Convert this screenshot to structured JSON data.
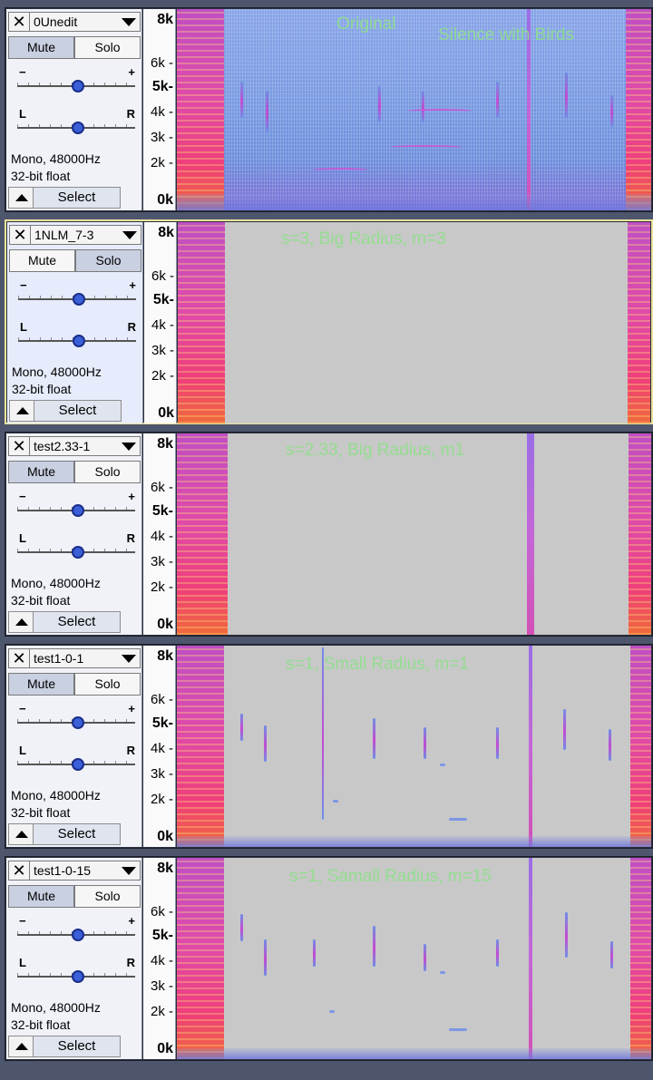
{
  "tracks": [
    {
      "name": "0Unedit",
      "mute_label": "Mute",
      "solo_label": "Solo",
      "gain_minus": "−",
      "gain_plus": "+",
      "pan_left": "L",
      "pan_right": "R",
      "info_line1": "Mono, 48000Hz",
      "info_line2": "32-bit float",
      "select_label": "Select",
      "annotations": [
        "Original",
        "Silence with Birds"
      ],
      "ticks": [
        "8k",
        "6k -",
        "5k-",
        "4k -",
        "3k -",
        "2k -",
        "0k"
      ]
    },
    {
      "name": "1NLM_7-3",
      "mute_label": "Mute",
      "solo_label": "Solo",
      "gain_minus": "−",
      "gain_plus": "+",
      "pan_left": "L",
      "pan_right": "R",
      "info_line1": "Mono, 48000Hz",
      "info_line2": "32-bit float",
      "select_label": "Select",
      "annotations": [
        "s=3, Big Radius, m=3"
      ],
      "ticks": [
        "8k",
        "6k -",
        "5k-",
        "4k -",
        "3k -",
        "2k -",
        "0k"
      ]
    },
    {
      "name": "test2.33-1",
      "mute_label": "Mute",
      "solo_label": "Solo",
      "gain_minus": "−",
      "gain_plus": "+",
      "pan_left": "L",
      "pan_right": "R",
      "info_line1": "Mono, 48000Hz",
      "info_line2": "32-bit float",
      "select_label": "Select",
      "annotations": [
        "s=2.33, Big Radius, m1"
      ],
      "ticks": [
        "8k",
        "6k -",
        "5k-",
        "4k -",
        "3k -",
        "2k -",
        "0k"
      ]
    },
    {
      "name": "test1-0-1",
      "mute_label": "Mute",
      "solo_label": "Solo",
      "gain_minus": "−",
      "gain_plus": "+",
      "pan_left": "L",
      "pan_right": "R",
      "info_line1": "Mono, 48000Hz",
      "info_line2": "32-bit float",
      "select_label": "Select",
      "annotations": [
        "s=1, Small   Radius, m=1"
      ],
      "ticks": [
        "8k",
        "6k -",
        "5k-",
        "4k -",
        "3k -",
        "2k -",
        "0k"
      ]
    },
    {
      "name": "test1-0-15",
      "mute_label": "Mute",
      "solo_label": "Solo",
      "gain_minus": "−",
      "gain_plus": "+",
      "pan_left": "L",
      "pan_right": "R",
      "info_line1": "Mono, 48000Hz",
      "info_line2": "32-bit float",
      "select_label": "Select",
      "annotations": [
        "s=1, Samall Radius, m=15"
      ],
      "ticks": [
        "8k",
        "6k -",
        "5k-",
        "4k -",
        "3k -",
        "2k -",
        "0k"
      ]
    }
  ],
  "close_glyph": "✕",
  "colors": {
    "selected_border": "#e8e39a",
    "annotation_text": "#8fe08a",
    "track_panel": "#f0f2f8",
    "spectrogram_background_processed": "#c8c8c8"
  }
}
